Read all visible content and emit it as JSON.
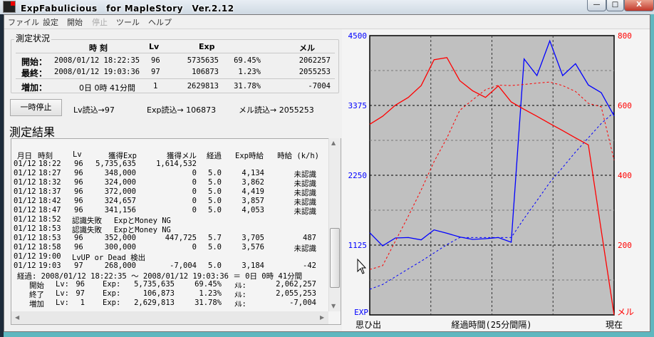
{
  "window": {
    "title": "ExpFabulicious　for MapleStory　Ver.2.12",
    "minimize": "—",
    "maximize": "□",
    "close": "X"
  },
  "menu": [
    {
      "label": "ファイル",
      "enabled": true
    },
    {
      "label": "設定",
      "enabled": true
    },
    {
      "label": "開始",
      "enabled": true
    },
    {
      "label": "停止",
      "enabled": false
    },
    {
      "label": "ツール",
      "enabled": true
    },
    {
      "label": "ヘルプ",
      "enabled": true
    }
  ],
  "status": {
    "legend": "測定状況",
    "headers": {
      "time": "時 刻",
      "lv": "Lv",
      "exp": "Exp",
      "mel": "メル"
    },
    "start": {
      "label": "開始：",
      "time": "2008/01/12  18:22:35",
      "lv": "96",
      "exp": "5735635",
      "pct": "69.45%",
      "mel": "2062257"
    },
    "last": {
      "label": "最終：",
      "time": "2008/01/12  19:03:36",
      "lv": "97",
      "exp": "106873",
      "pct": "1.23%",
      "mel": "2055253"
    },
    "gain": {
      "label": "増加：",
      "time": "0日  0時  41分間",
      "lv": "1",
      "exp": "2629813",
      "pct": "31.78%",
      "mel": "-7004"
    }
  },
  "controls": {
    "pause": "一時停止",
    "lv_read": "Lv読込→97",
    "exp_read": "Exp読込→ 106873",
    "mel_read": "メル読込→ 2055253"
  },
  "results": {
    "title": "測定結果",
    "header": {
      "date": "月日",
      "time": "時刻",
      "lv": "Lv",
      "exp": "獲得Exp",
      "mel": "獲得メル",
      "elapsed": "経過",
      "rate": "Exp時給",
      "hourly": "時給 (k/h)"
    },
    "rows": [
      {
        "date": "01/12",
        "time": "18:22",
        "lv": "96",
        "exp": "5,735,635",
        "mel": "1,614,532",
        "elapsed": "",
        "rate": "",
        "hourly": ""
      },
      {
        "date": "01/12",
        "time": "18:27",
        "lv": "96",
        "exp": "348,000",
        "mel": "0",
        "elapsed": "5.0",
        "rate": "4,134",
        "hourly": "未認識"
      },
      {
        "date": "01/12",
        "time": "18:32",
        "lv": "96",
        "exp": "324,000",
        "mel": "0",
        "elapsed": "5.0",
        "rate": "3,862",
        "hourly": "未認識"
      },
      {
        "date": "01/12",
        "time": "18:37",
        "lv": "96",
        "exp": "372,000",
        "mel": "0",
        "elapsed": "5.0",
        "rate": "4,419",
        "hourly": "未認識"
      },
      {
        "date": "01/12",
        "time": "18:42",
        "lv": "96",
        "exp": "324,657",
        "mel": "0",
        "elapsed": "5.0",
        "rate": "3,857",
        "hourly": "未認識"
      },
      {
        "date": "01/12",
        "time": "18:47",
        "lv": "96",
        "exp": "341,156",
        "mel": "0",
        "elapsed": "5.0",
        "rate": "4,053",
        "hourly": "未認識"
      },
      {
        "date": "01/12",
        "time": "18:52",
        "message": "認識失敗　 ExpとMoney NG"
      },
      {
        "date": "01/12",
        "time": "18:53",
        "message": "認識失敗　 ExpとMoney NG"
      },
      {
        "date": "01/12",
        "time": "18:53",
        "lv": "96",
        "exp": "352,000",
        "mel": "447,725",
        "elapsed": "5.7",
        "rate": "3,705",
        "hourly": "487"
      },
      {
        "date": "01/12",
        "time": "18:58",
        "lv": "96",
        "exp": "300,000",
        "mel": "0",
        "elapsed": "5.0",
        "rate": "3,576",
        "hourly": "未認識"
      },
      {
        "date": "01/12",
        "time": "19:00",
        "message": "LvUP or Dead 検出"
      },
      {
        "date": "01/12",
        "time": "19:03",
        "lv": "97",
        "exp": "268,000",
        "mel": "-7,004",
        "elapsed": "5.0",
        "rate": "3,184",
        "hourly": "-42"
      }
    ],
    "summary_elapsed": "経過: 2008/01/12 18:22:35  ～  2008/01/12 19:03:36  ＝  0日 0時 41分間",
    "summary": [
      {
        "label": "開始",
        "lv_label": "Lv:",
        "lv": "96",
        "exp_label": "Exp:",
        "exp": "5,735,635",
        "pct": "69.45%",
        "mel_label": "ﾒﾙ:",
        "mel": "2,062,257"
      },
      {
        "label": "終了",
        "lv_label": "Lv:",
        "lv": "97",
        "exp_label": "Exp:",
        "exp": "106,873",
        "pct": "1.23%",
        "mel_label": "ﾒﾙ:",
        "mel": "2,055,253"
      },
      {
        "label": "増加",
        "lv_label": "Lv:",
        "lv": "1",
        "exp_label": "Exp:",
        "exp": "2,629,813",
        "pct": "31.78%",
        "mel_label": "ﾒﾙ:",
        "mel": "-7,004"
      }
    ]
  },
  "chart_data": {
    "type": "line",
    "xlabel": "経過時間(25分間隔)",
    "x_start_label": "思ひ出",
    "x_end_label": "現在",
    "left_axis": {
      "label": "EXP",
      "ylim": [
        0,
        4500
      ],
      "ticks": [
        "4500",
        "3375",
        "2250",
        "1125"
      ],
      "color": "#0000ff"
    },
    "right_axis": {
      "label": "メル",
      "ylim": [
        0,
        800
      ],
      "ticks": [
        "800",
        "600",
        "400",
        "200"
      ],
      "color": "#ff0000"
    },
    "background": "#c0c0c0",
    "grid": true,
    "series": [
      {
        "axis": "left",
        "style": "solid",
        "color": "#0000ff",
        "values": [
          1324,
          1113,
          1240,
          1247,
          1209,
          1370,
          1316,
          1255,
          1217,
          1228,
          1247,
          1171,
          4124,
          3856,
          4415,
          3856,
          4048,
          3704,
          3581,
          3206
        ]
      },
      {
        "axis": "left",
        "style": "dashed",
        "color": "#0000ff",
        "values": [
          413,
          490,
          616,
          742,
          865,
          998,
          1133,
          1247,
          1247,
          1247,
          1247,
          1247,
          1553,
          1841,
          2135,
          2376,
          2625,
          2854,
          3084,
          3267
        ]
      },
      {
        "axis": "right",
        "style": "solid",
        "color": "#ff0000",
        "values": [
          546,
          569,
          601,
          623,
          657,
          731,
          737,
          671,
          642,
          623,
          656,
          610,
          589,
          569,
          548,
          528,
          507,
          487,
          242,
          0
        ]
      },
      {
        "axis": "right",
        "style": "dashed",
        "color": "#ff0000",
        "values": [
          130,
          141,
          212,
          283,
          358,
          439,
          507,
          586,
          616,
          645,
          658,
          657,
          660,
          664,
          667,
          657,
          640,
          606,
          596,
          443
        ]
      }
    ]
  }
}
